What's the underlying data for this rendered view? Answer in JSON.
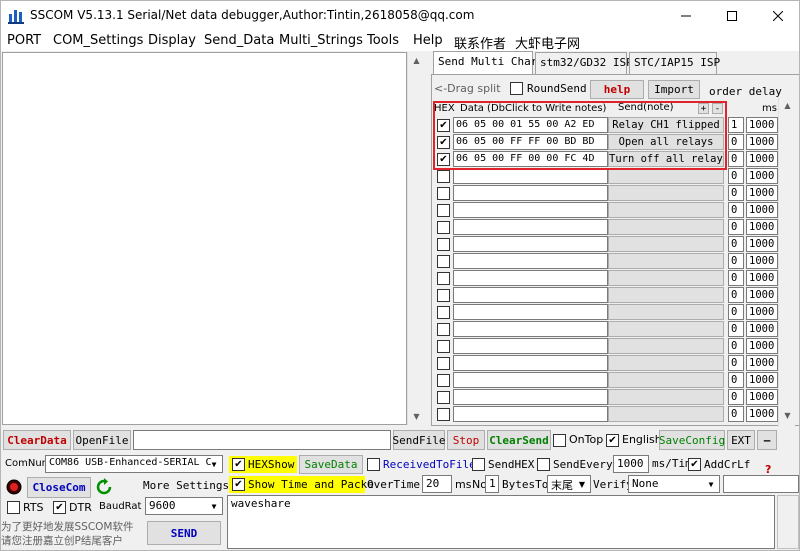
{
  "window": {
    "title": "SSCOM V5.13.1 Serial/Net data debugger,Author:Tintin,2618058@qq.com"
  },
  "menu": [
    "PORT",
    "COM_Settings",
    "Display",
    "Send_Data",
    "Multi_Strings",
    "Tools",
    "Help",
    "联系作者",
    "大虾电子网"
  ],
  "tabs": [
    "Send Multi Char",
    "stm32/GD32 ISP",
    "STC/IAP15 ISP"
  ],
  "multi_panel": {
    "drag_split": "<-Drag split",
    "round_send": "RoundSend",
    "help": "help",
    "import": "Import",
    "order_delay": "order delay",
    "hex_header": "HEX",
    "data_header": "Data (DbClick to Write notes)",
    "send_header": "Send(note)",
    "plus": "+",
    "minus": "-",
    "ms_header": "ms",
    "rows": [
      {
        "checked": true,
        "data": "06 05 00 01 55 00 A2 ED",
        "note": "Relay CH1 flipped",
        "order": "1",
        "delay": "1000"
      },
      {
        "checked": true,
        "data": "06 05 00 FF FF 00 BD BD",
        "note": "Open all relays",
        "order": "0",
        "delay": "1000"
      },
      {
        "checked": true,
        "data": "06 05 00 FF 00 00 FC 4D",
        "note": "Turn off all relays",
        "order": "0",
        "delay": "1000"
      },
      {
        "checked": false,
        "data": "",
        "note": "",
        "order": "0",
        "delay": "1000"
      },
      {
        "checked": false,
        "data": "",
        "note": "",
        "order": "0",
        "delay": "1000"
      },
      {
        "checked": false,
        "data": "",
        "note": "",
        "order": "0",
        "delay": "1000"
      },
      {
        "checked": false,
        "data": "",
        "note": "",
        "order": "0",
        "delay": "1000"
      },
      {
        "checked": false,
        "data": "",
        "note": "",
        "order": "0",
        "delay": "1000"
      },
      {
        "checked": false,
        "data": "",
        "note": "",
        "order": "0",
        "delay": "1000"
      },
      {
        "checked": false,
        "data": "",
        "note": "",
        "order": "0",
        "delay": "1000"
      },
      {
        "checked": false,
        "data": "",
        "note": "",
        "order": "0",
        "delay": "1000"
      },
      {
        "checked": false,
        "data": "",
        "note": "",
        "order": "0",
        "delay": "1000"
      },
      {
        "checked": false,
        "data": "",
        "note": "",
        "order": "0",
        "delay": "1000"
      },
      {
        "checked": false,
        "data": "",
        "note": "",
        "order": "0",
        "delay": "1000"
      },
      {
        "checked": false,
        "data": "",
        "note": "",
        "order": "0",
        "delay": "1000"
      },
      {
        "checked": false,
        "data": "",
        "note": "",
        "order": "0",
        "delay": "1000"
      },
      {
        "checked": false,
        "data": "",
        "note": "",
        "order": "0",
        "delay": "1000"
      },
      {
        "checked": false,
        "data": "",
        "note": "",
        "order": "0",
        "delay": "1000"
      }
    ]
  },
  "toolbar": {
    "clear_data": "ClearData",
    "open_file": "OpenFile",
    "send_file": "SendFile",
    "stop": "Stop",
    "clear_send": "ClearSend",
    "on_top": "OnTop",
    "english": "English",
    "save_config": "SaveConfig",
    "ext": "EXT",
    "dash": "—"
  },
  "bottom": {
    "com_num_label": "ComNum",
    "com_num_value": "COM86 USB-Enhanced-SERIAL C",
    "close_com": "CloseCom",
    "more_settings": "More Settings",
    "rts": "RTS",
    "dtr": "DTR",
    "baud_label": "BaudRat",
    "baud_value": "9600",
    "hex_show": "HEXShow",
    "save_data": "SaveData",
    "received_to_file": "ReceivedToFile",
    "send_hex": "SendHEX",
    "send_every": "SendEvery:",
    "send_every_value": "1000",
    "ms_tim": "ms/Tim",
    "add_crlf": "AddCrLf",
    "show_time": "Show Time and Packe",
    "overtime": "OverTime:",
    "overtime_value": "20",
    "ms": "ms",
    "no": "No",
    "no_value": "1",
    "bytes_to": "BytesTo",
    "bytes_to_value": "末尾",
    "verify": "Verify",
    "verify_value": "None",
    "question": "?",
    "send_text": "waveshare",
    "send_btn": "SEND",
    "promo_line1": "为了更好地发展SSCOM软件",
    "promo_line2": "请您注册嘉立创P结尾客户"
  },
  "colors": {
    "red_text": "#c00000",
    "green_text": "#008000",
    "blue_text": "#0000c0",
    "highlight_frame": "#e0242c",
    "yellow_highlight": "#ffff00"
  }
}
